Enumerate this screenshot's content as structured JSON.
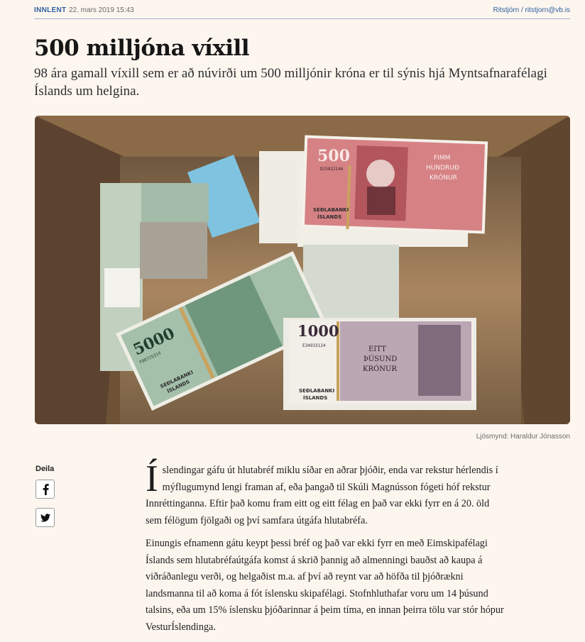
{
  "meta": {
    "category": "INNLENT",
    "date": "22. mars 2019 15:43",
    "author": "Ritstjórn / ritstjorn@vb.is"
  },
  "article": {
    "headline": "500 milljóna víxill",
    "lede": "98 ára gamall víxill sem er að núvirði um 500 milljónir króna er til sýnis hjá Myntsafnarafélagi Íslands um helgina.",
    "photo_caption": "Ljósmynd: Haraldur Jónasson",
    "dropcap": "Í",
    "paragraph1": "slendingar gáfu út hlutabréf miklu síðar en aðrar þjóðir, enda var rekstur hérlendis í mýflugumynd lengi framan af, eða þangað til Skúli Magnússon fógeti hóf rekstur Innréttinganna. Eftir það komu fram eitt og eitt félag en það var ekki fyrr en á 20. öld sem félögum fjölgaði og því samfara útgáfa hlutabréfa.",
    "paragraph2": "Einungis efnamenn gátu keypt þessi bréf og það var ekki fyrr en með Eimskipafélagi Íslands sem hlutabréfaútgáfa komst á skrið þannig að almenningi bauðst að kaupa á viðráðanlegu verði, og helgaðist m.a. af því að reynt var að höfða til þjóðrækni landsmanna til að koma á fót íslensku skipafélagi. Stofnhluthafar voru um 14 þúsund talsins, eða um 15% íslensku þjóðarinnar á þeim tíma, en innan þeirra tölu var stór hópur VesturÍslendinga."
  },
  "share": {
    "label": "Deila",
    "facebook_icon": "facebook-icon",
    "twitter_icon": "twitter-icon"
  },
  "photo_text": {
    "note500_value": "500",
    "note500_words1": "FIMM",
    "note500_words2": "HUNDRUÐ",
    "note500_words3": "KRÓNUR",
    "note500_serial": "D25812146",
    "note1000_value": "1000",
    "note1000_words1": "EITT",
    "note1000_words2": "ÞÚSUND",
    "note1000_words3": "KRÓNUR",
    "note1000_serial": "E34933124",
    "note5000_value": "5000",
    "note5000_serial": "F08725314",
    "bank_name1": "SEÐLABANKI",
    "bank_name2": "ÍSLANDS"
  },
  "colors": {
    "accent": "#2f5f9e",
    "background": "#fdf6ef",
    "rule": "#9fb0c8",
    "note500": "#c4464f",
    "note1000": "#8e6a87",
    "note5000": "#3f7a58",
    "box": "#b7946b"
  }
}
